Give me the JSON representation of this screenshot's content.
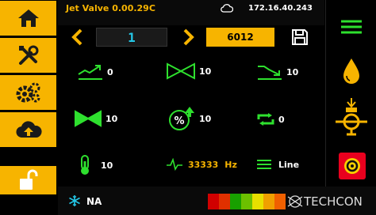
{
  "header": {
    "title": "Jet Valve 0.00.29C",
    "ip": "172.16.40.243"
  },
  "selector": {
    "index": "1",
    "id": "6012"
  },
  "metrics": {
    "rise": "0",
    "valve_open": "10",
    "fall": "10",
    "valve_closed": "10",
    "percent_up": "10",
    "cycle": "0",
    "temperature": "10",
    "frequency": "33333",
    "frequency_unit": "Hz",
    "mode": "Line"
  },
  "footer": {
    "snow_value": "NA",
    "brand": "TECHCON",
    "level_colors": [
      "#d00000",
      "#e03000",
      "#18a000",
      "#6cc000",
      "#e8e000",
      "#f0a000",
      "#f06000"
    ]
  },
  "colors": {
    "accent": "#f7b400",
    "green": "#2ee02e",
    "cyan": "#24c8e8",
    "alarm": "#e8001e"
  }
}
